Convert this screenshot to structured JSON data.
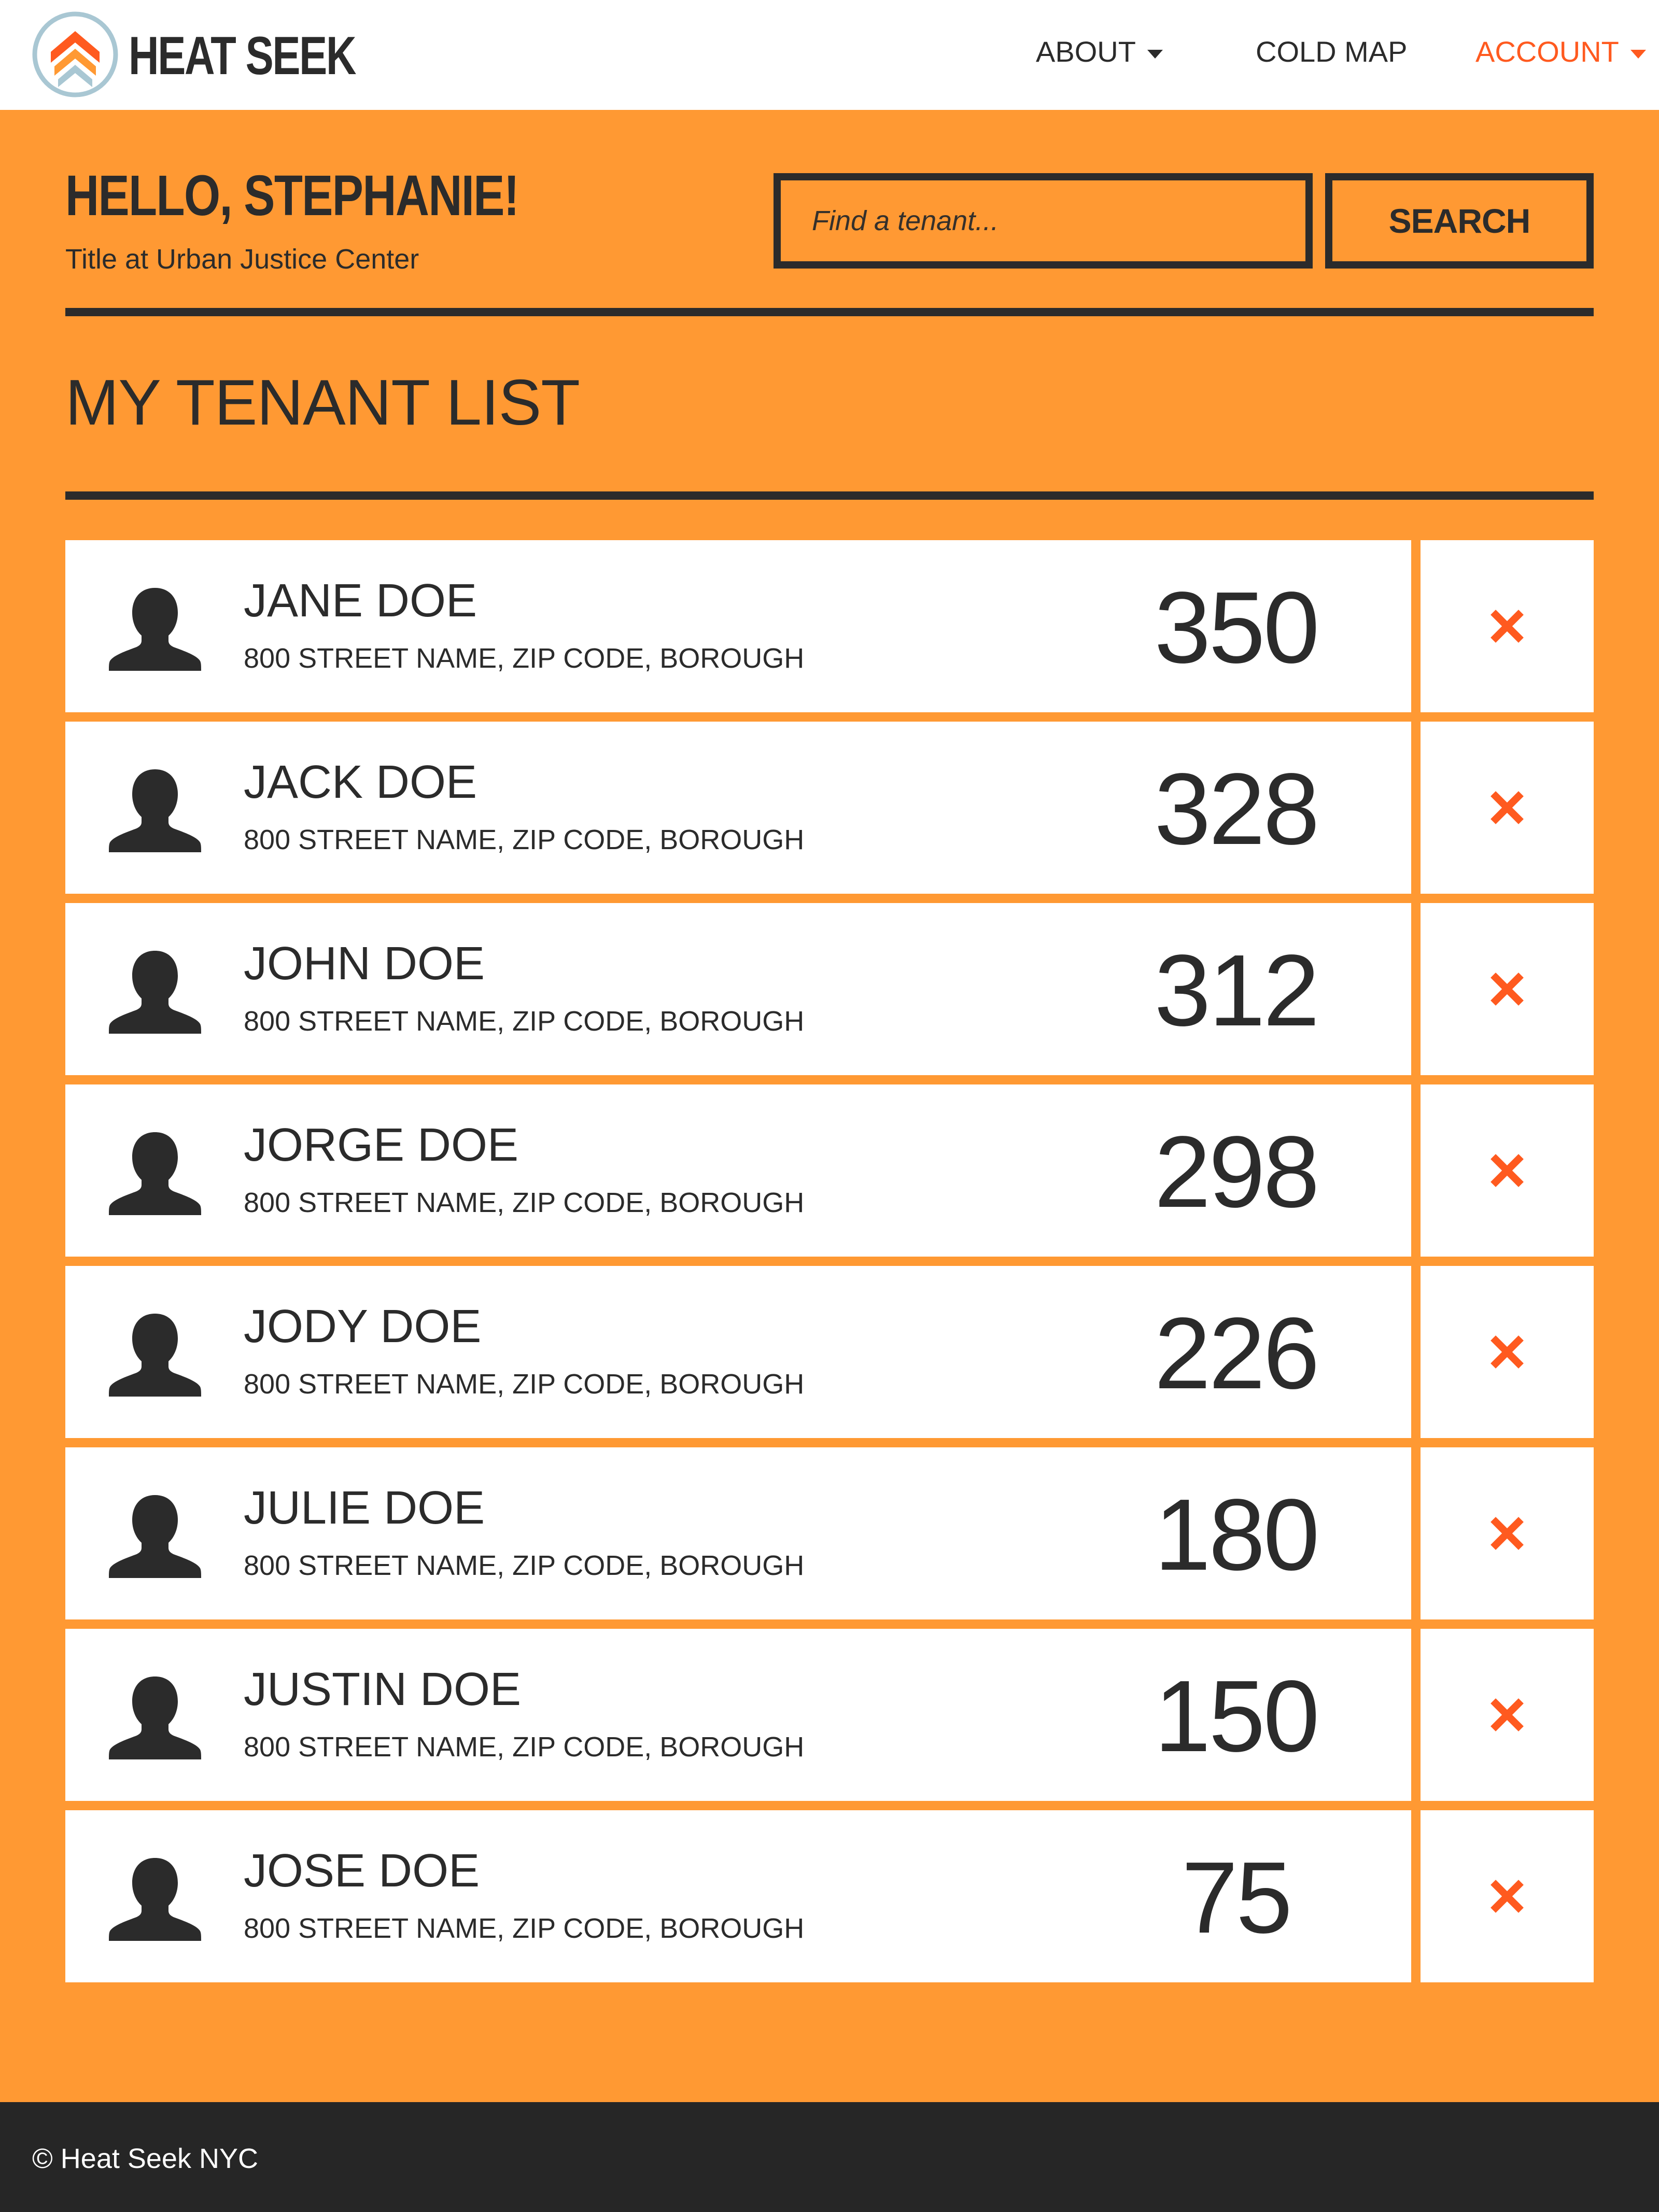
{
  "nav": {
    "brand": "HEAT SEEK",
    "logo_icon": "house-chevron-logo-icon",
    "items": [
      {
        "label": "ABOUT",
        "has_dropdown": true,
        "active": false
      },
      {
        "label": "COLD MAP",
        "has_dropdown": false,
        "active": false
      },
      {
        "label": "ACCOUNT",
        "has_dropdown": true,
        "active": true
      }
    ]
  },
  "header": {
    "greeting": "HELLO, STEPHANIE!",
    "subtitle": "Title at Urban Justice Center",
    "search_placeholder": "Find a tenant...",
    "search_value": "",
    "search_button": "SEARCH"
  },
  "list": {
    "title": "MY TENANT LIST",
    "tenants": [
      {
        "name": "JANE DOE",
        "address": "800 STREET NAME, ZIP CODE, BOROUGH",
        "count": "350"
      },
      {
        "name": "JACK DOE",
        "address": "800 STREET NAME, ZIP CODE, BOROUGH",
        "count": "328"
      },
      {
        "name": "JOHN DOE",
        "address": "800 STREET NAME, ZIP CODE, BOROUGH",
        "count": "312"
      },
      {
        "name": "JORGE DOE",
        "address": "800 STREET NAME, ZIP CODE, BOROUGH",
        "count": "298"
      },
      {
        "name": "JODY DOE",
        "address": "800 STREET NAME, ZIP CODE, BOROUGH",
        "count": "226"
      },
      {
        "name": "JULIE DOE",
        "address": "800 STREET NAME, ZIP CODE, BOROUGH",
        "count": "180"
      },
      {
        "name": "JUSTIN DOE",
        "address": "800 STREET NAME, ZIP CODE, BOROUGH",
        "count": "150"
      },
      {
        "name": "JOSE DOE",
        "address": "800 STREET NAME, ZIP CODE, BOROUGH",
        "count": "75"
      }
    ],
    "row_icons": {
      "avatar": "person-avatar-icon",
      "remove": "close-x-icon"
    }
  },
  "footer": {
    "copyright": "© Heat Seek NYC"
  },
  "colors": {
    "background": "#ff9933",
    "accent": "#ff5a1f",
    "dark": "#2b2b2b",
    "footer": "#262626",
    "card": "#ffffff"
  }
}
